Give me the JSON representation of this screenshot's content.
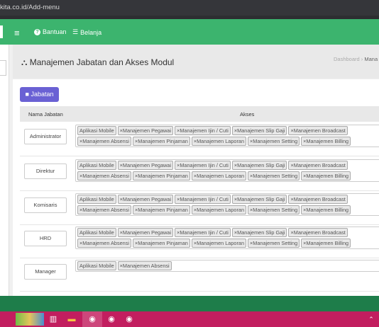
{
  "browser": {
    "url": "kita.co.id/Add-menu"
  },
  "topnav": {
    "help_label": "Bantuan",
    "shop_label": "Belanja"
  },
  "header": {
    "title": "Manajemen Jabatan dan Akses Modul",
    "breadcrumb_home": "Dashboard",
    "breadcrumb_sep": "›",
    "breadcrumb_current": "Mana"
  },
  "toolbar": {
    "add_label": "Jabatan"
  },
  "table": {
    "col_name": "Nama Jabatan",
    "col_akses": "Akses",
    "rows": [
      {
        "name": "Administrator",
        "tags": [
          "Aplikasi Mobile",
          "×Manajemen Pegawai",
          "×Manajemen Ijin / Cuti",
          "×Manajemen Slip Gaji",
          "×Manajemen Broadcast",
          "×Manajemen Absensi",
          "×Manajemen Pinjaman",
          "×Manajemen Laporan",
          "×Manajemen Setting",
          "×Manajemen Billing"
        ]
      },
      {
        "name": "Direktur",
        "tags": [
          "Aplikasi Mobile",
          "×Manajemen Pegawai",
          "×Manajemen Ijin / Cuti",
          "×Manajemen Slip Gaji",
          "×Manajemen Broadcast",
          "×Manajemen Absensi",
          "×Manajemen Pinjaman",
          "×Manajemen Laporan",
          "×Manajemen Setting",
          "×Manajemen Billing"
        ]
      },
      {
        "name": "Komisaris",
        "tags": [
          "Aplikasi Mobile",
          "×Manajemen Pegawai",
          "×Manajemen Ijin / Cuti",
          "×Manajemen Slip Gaji",
          "×Manajemen Broadcast",
          "×Manajemen Absensi",
          "×Manajemen Pinjaman",
          "×Manajemen Laporan",
          "×Manajemen Setting",
          "×Manajemen Billing"
        ]
      },
      {
        "name": "HRD",
        "tags": [
          "Aplikasi Mobile",
          "×Manajemen Pegawai",
          "×Manajemen Ijin / Cuti",
          "×Manajemen Slip Gaji",
          "×Manajemen Broadcast",
          "×Manajemen Absensi",
          "×Manajemen Pinjaman",
          "×Manajemen Laporan",
          "×Manajemen Setting",
          "×Manajemen Billing"
        ]
      },
      {
        "name": "Manager",
        "tags": [
          "Aplikasi Mobile",
          "×Manajemen Absensi"
        ]
      }
    ]
  },
  "colors": {
    "nav_green": "#3cb46e",
    "accent_purple": "#6a61d4",
    "taskbar": "#c21e5f"
  }
}
